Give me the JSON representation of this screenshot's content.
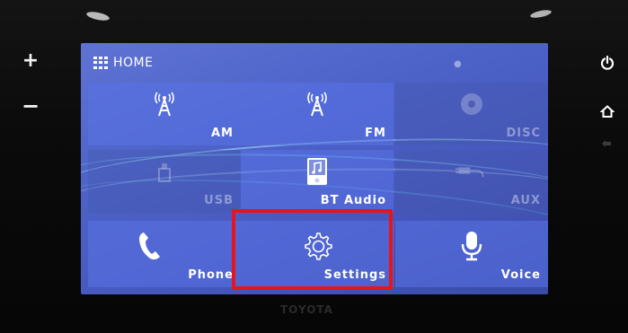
{
  "hardware": {
    "volume_up": "+",
    "volume_down": "−",
    "brand": "TOYOTA"
  },
  "screen": {
    "title": "HOME",
    "tiles": [
      {
        "label": "AM",
        "icon": "radio-tower-icon",
        "enabled": true
      },
      {
        "label": "FM",
        "icon": "radio-tower-icon",
        "enabled": true
      },
      {
        "label": "DISC",
        "icon": "disc-icon",
        "enabled": false
      },
      {
        "label": "USB",
        "icon": "usb-icon",
        "enabled": false
      },
      {
        "label": "BT Audio",
        "icon": "music-file-icon",
        "enabled": true
      },
      {
        "label": "AUX",
        "icon": "aux-cable-icon",
        "enabled": false
      },
      {
        "label": "Phone",
        "icon": "phone-icon",
        "enabled": true
      },
      {
        "label": "Settings",
        "icon": "gear-icon",
        "enabled": true
      },
      {
        "label": "Voice",
        "icon": "microphone-icon",
        "enabled": true
      }
    ]
  },
  "colors": {
    "screen_blue": "#4d63c8",
    "highlight": "#e8141a"
  }
}
